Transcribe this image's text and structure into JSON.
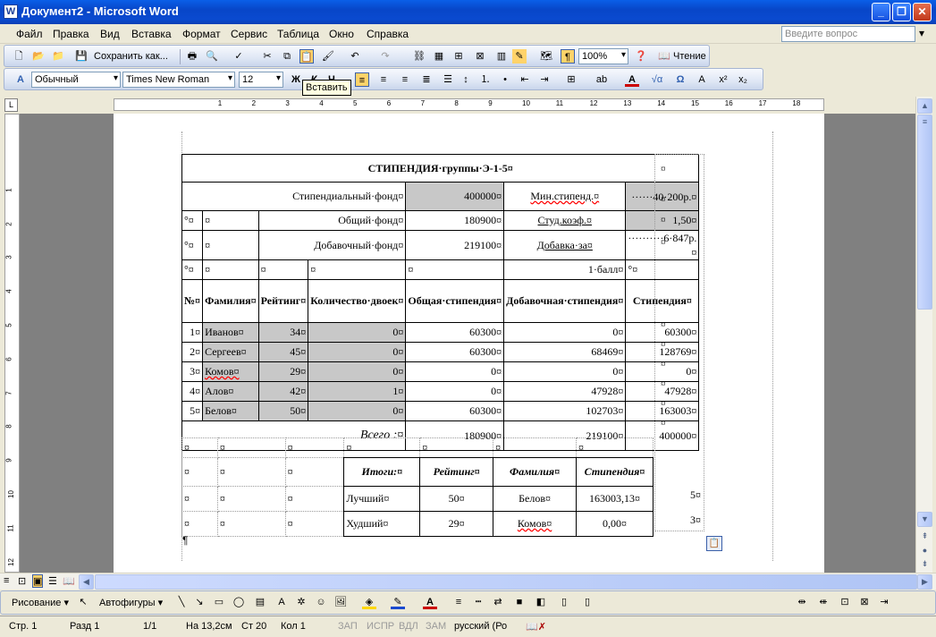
{
  "window": {
    "title": "Документ2 - Microsoft Word"
  },
  "menu": {
    "items": [
      "Файл",
      "Правка",
      "Вид",
      "Вставка",
      "Формат",
      "Сервис",
      "Таблица",
      "Окно",
      "Справка"
    ],
    "ask_placeholder": "Введите вопрос"
  },
  "toolbar": {
    "save_as": "Сохранить как...",
    "zoom": "100%",
    "reading": "Чтение"
  },
  "format": {
    "style": "Обычный",
    "font": "Times New Roman",
    "size": "12",
    "bold": "Ж",
    "italic": "К",
    "underline": "Ч"
  },
  "tooltip": "Вставить",
  "doc": {
    "title": "СТИПЕНДИЯ·группы·Э-1-5¤",
    "fund_label": "Стипендиальный·фонд¤",
    "fund_value": "400000¤",
    "minstip_label": "Мин.стипенд.¤",
    "minstip_value": "······40·200р.¤",
    "common_label": "Общий·фонд¤",
    "common_value": "180900¤",
    "coef_label": "Студ.коэф.¤",
    "coef_value": "1,50¤",
    "add_label": "Добавочный·фонд¤",
    "add_value": "219100¤",
    "bonus_label": "Добавка·за¤",
    "bonus_value": "··········6·847р.¤",
    "ball_label": "1·балл¤",
    "headers": [
      "№¤",
      "Фамилия¤",
      "Рейтинг¤",
      "Количество·двоек¤",
      "Общая·стипендия¤",
      "Добавочная·стипендия¤",
      "Стипендия¤"
    ],
    "rows": [
      [
        "1¤",
        "Иванов¤",
        "34¤",
        "0¤",
        "60300¤",
        "0¤",
        "60300¤"
      ],
      [
        "2¤",
        "Сергеев¤",
        "45¤",
        "0¤",
        "60300¤",
        "68469¤",
        "128769¤"
      ],
      [
        "3¤",
        "Комов¤",
        "29¤",
        "0¤",
        "0¤",
        "0¤",
        "0¤"
      ],
      [
        "4¤",
        "Алов¤",
        "42¤",
        "1¤",
        "0¤",
        "47928¤",
        "47928¤"
      ],
      [
        "5¤",
        "Белов¤",
        "50¤",
        "0¤",
        "60300¤",
        "102703¤",
        "163003¤"
      ]
    ],
    "total_label": "Всего :¤",
    "totals": [
      "180900¤",
      "219100¤",
      "400000¤"
    ],
    "summary_headers": [
      "Итоги:¤",
      "Рейтинг¤",
      "Фамилия¤",
      "Стипендия¤"
    ],
    "summary_rows": [
      [
        "Лучший¤",
        "50¤",
        "Белов¤",
        "163003,13¤",
        "5¤"
      ],
      [
        "Худший¤",
        "29¤",
        "Комов¤",
        "0,00¤",
        "3¤"
      ]
    ],
    "cell_mark": "¤",
    "para_mark": "¶"
  },
  "drawbar": {
    "drawing": "Рисование ▾",
    "autoshapes": "Автофигуры ▾"
  },
  "status": {
    "page": "Стр.  1",
    "section": "Разд  1",
    "pages": "1/1",
    "at": "На  13,2см",
    "line": "Ст  20",
    "col": "Кол  1",
    "rec": "ЗАП",
    "trk": "ИСПР",
    "ext": "ВДЛ",
    "ovr": "ЗАМ",
    "lang": "русский (Ро"
  }
}
